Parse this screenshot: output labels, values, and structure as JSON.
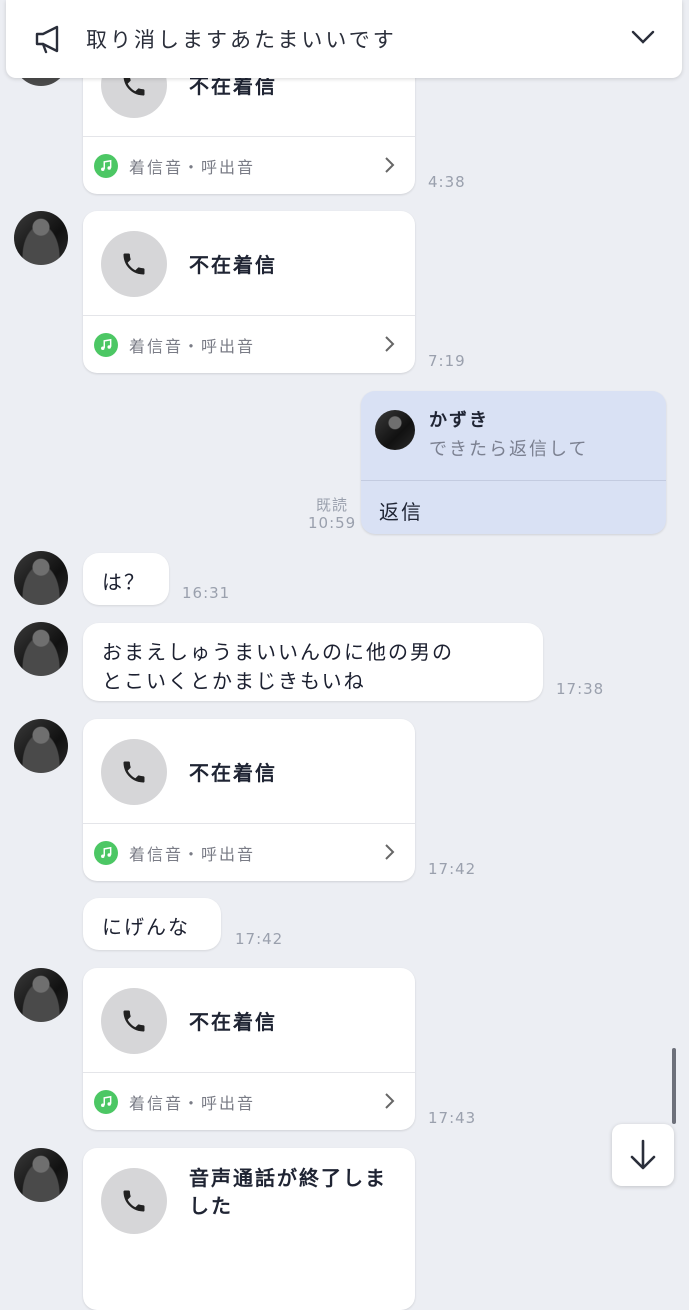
{
  "announcement": {
    "text": "取り消しますあたまいいです"
  },
  "contact": {
    "name": "かずき"
  },
  "messages": {
    "call1": {
      "title": "不在着信",
      "ringtone": "着信音・呼出音",
      "time": "4:38"
    },
    "call2": {
      "title": "不在着信",
      "ringtone": "着信音・呼出音",
      "time": "7:19"
    },
    "sent": {
      "quote_name": "かずき",
      "quote_text": "できたら返信して",
      "text": "返信",
      "read": "既読",
      "time": "10:59"
    },
    "msg1": {
      "text": "は？",
      "time": "16:31"
    },
    "msg2": {
      "line1": "おまえしゅうまいいんのに他の男の",
      "line2": "とこいくとかまじきもいね",
      "time": "17:38"
    },
    "call3": {
      "title": "不在着信",
      "ringtone": "着信音・呼出音",
      "time": "17:42"
    },
    "msg3": {
      "text": "にげんな",
      "time": "17:42"
    },
    "call4": {
      "title": "不在着信",
      "ringtone": "着信音・呼出音",
      "time": "17:43"
    },
    "call5": {
      "line1": "音声通話が終了しま",
      "line2": "した"
    }
  },
  "colors": {
    "sent_bubble": "#d9e1f4",
    "music_icon": "#4cc764",
    "background": "#eceef3"
  },
  "icons": {
    "announce": "megaphone-icon",
    "collapse": "chevron-down-icon",
    "phone": "phone-icon",
    "music": "music-note-icon",
    "arrow": "chevron-right-icon",
    "scroll_down": "arrow-down-icon"
  }
}
